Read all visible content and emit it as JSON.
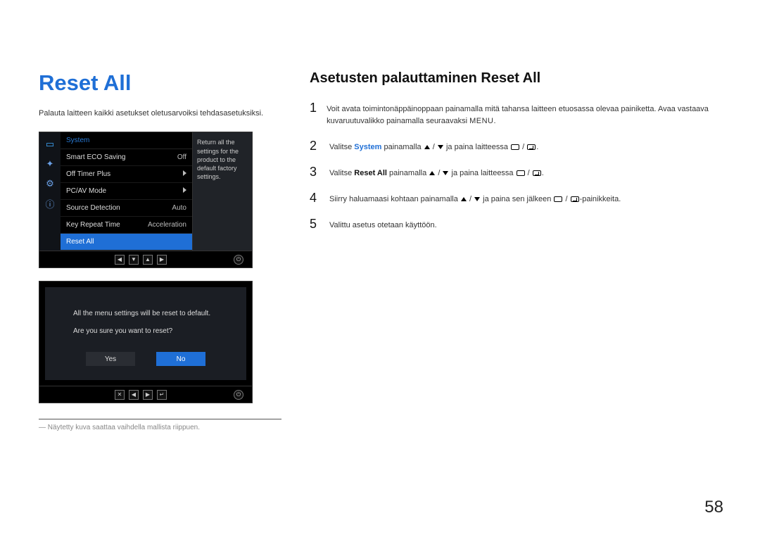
{
  "title": "Reset All",
  "intro": "Palauta laitteen kaikki asetukset oletusarvoiksi tehdasasetuksiksi.",
  "subtitle": "Asetusten palauttaminen Reset All",
  "osd": {
    "header": "System",
    "desc": "Return all the settings for the product to the default factory settings.",
    "rows": [
      {
        "label": "Smart ECO Saving",
        "value": "Off"
      },
      {
        "label": "Off Timer Plus",
        "value": ""
      },
      {
        "label": "PC/AV Mode",
        "value": ""
      },
      {
        "label": "Source Detection",
        "value": "Auto"
      },
      {
        "label": "Key Repeat Time",
        "value": "Acceleration"
      },
      {
        "label": "Reset All",
        "value": ""
      }
    ]
  },
  "dialog": {
    "line1": "All the menu settings will be reset to default.",
    "line2": "Are you sure you want to reset?",
    "yes": "Yes",
    "no": "No"
  },
  "footnote": "Näytetty kuva saattaa vaihdella mallista riippuen.",
  "steps": {
    "s1a": "Voit avata toimintonäppäinoppaan painamalla mitä tahansa laitteen etuosassa olevaa painiketta. Avaa vastaava kuvaruutuvalikko painamalla seuraavaksi ",
    "s1b": "MENU",
    "s1c": ".",
    "s2a": "Valitse ",
    "s2b": "System",
    "s2c": " painamalla ",
    "s2d": " ja paina laitteessa ",
    "s2e": ".",
    "s3a": "Valitse ",
    "s3b": "Reset All",
    "s3c": " painamalla ",
    "s3d": " ja paina laitteessa ",
    "s3e": ".",
    "s4a": "Siirry haluamaasi kohtaan painamalla ",
    "s4b": " ja paina sen jälkeen ",
    "s4c": "-painikkeita.",
    "s5": "Valittu asetus otetaan käyttöön."
  },
  "nums": {
    "n1": "1",
    "n2": "2",
    "n3": "3",
    "n4": "4",
    "n5": "5"
  },
  "page_number": "58"
}
